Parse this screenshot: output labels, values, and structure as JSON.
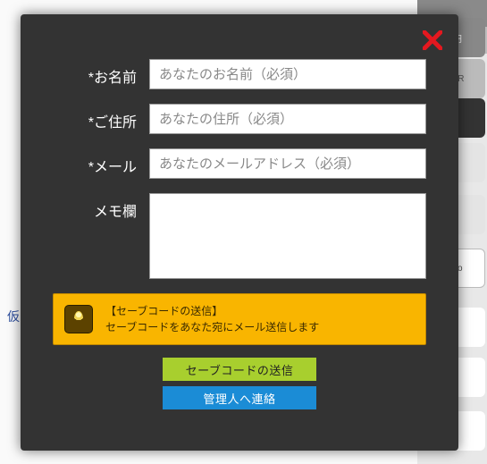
{
  "form": {
    "name": {
      "label": "*お名前",
      "placeholder": "あなたのお名前（必須）"
    },
    "address": {
      "label": "*ご住所",
      "placeholder": "あなたの住所（必須）"
    },
    "email": {
      "label": "*メール",
      "placeholder": "あなたのメールアドレス（必須）"
    },
    "memo": {
      "label": "メモ欄",
      "placeholder": ""
    }
  },
  "info": {
    "line1": "【セーブコードの送信】",
    "line2": "セーブコードをあなた宛にメール送信します"
  },
  "buttons": {
    "send": "セーブコードの送信",
    "contact": "管理人へ連絡"
  },
  "bg": {
    "d1": "円",
    "d2": "QR",
    "d6": "bo",
    "chip": "仮"
  }
}
